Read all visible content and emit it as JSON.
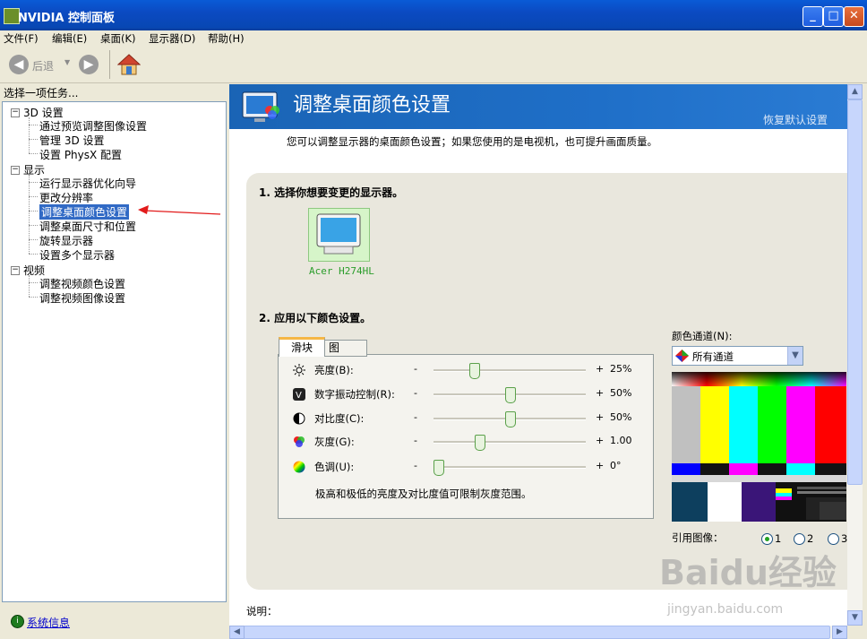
{
  "window": {
    "title": "NVIDIA 控制面板",
    "min": "_",
    "max": "□",
    "close": "✕"
  },
  "menu": [
    "文件(F)",
    "编辑(E)",
    "桌面(K)",
    "显示器(D)",
    "帮助(H)"
  ],
  "toolbar": {
    "back": "后退"
  },
  "left": {
    "header": "选择一项任务...",
    "groups": [
      {
        "label": "3D 设置",
        "items": [
          "通过预览调整图像设置",
          "管理 3D 设置",
          "设置 PhysX 配置"
        ]
      },
      {
        "label": "显示",
        "items": [
          "运行显示器优化向导",
          "更改分辨率",
          "调整桌面颜色设置",
          "调整桌面尺寸和位置",
          "旋转显示器",
          "设置多个显示器"
        ]
      },
      {
        "label": "视频",
        "items": [
          "调整视频颜色设置",
          "调整视频图像设置"
        ]
      }
    ],
    "selected": "调整桌面颜色设置",
    "sysinfo": "系统信息"
  },
  "page": {
    "title": "调整桌面颜色设置",
    "restore": "恢复默认设置",
    "intro": "您可以调整显示器的桌面颜色设置；如果您使用的是电视机，也可提升画面质量。",
    "step1": "1. 选择你想要变更的显示器。",
    "monitor": "Acer H274HL",
    "step2": "2. 应用以下颜色设置。",
    "tabs": {
      "slider": "滑块",
      "graph": "图"
    },
    "sliders": [
      {
        "label": "亮度(B):",
        "value": "25%",
        "level": 0.25,
        "icon": "brightness-icon"
      },
      {
        "label": "数字振动控制(R):",
        "value": "50%",
        "level": 0.5,
        "icon": "vibrance-icon"
      },
      {
        "label": "对比度(C):",
        "value": "50%",
        "level": 0.5,
        "icon": "contrast-icon"
      },
      {
        "label": "灰度(G):",
        "value": "1.00",
        "level": 0.29,
        "icon": "gamma-icon"
      },
      {
        "label": "色调(U):",
        "value": "0°",
        "level": 0.0,
        "icon": "hue-icon"
      }
    ],
    "minus": "-",
    "plus": "+",
    "note": "极高和极低的亮度及对比度值可限制灰度范围。",
    "channel_label": "颜色通道(N):",
    "channel_value": "所有通道",
    "ref_label": "引用图像：",
    "ref_options": [
      "1",
      "2",
      "3"
    ],
    "ref_selected": "1",
    "desc_label": "说明："
  },
  "watermark": {
    "main": "Baidu经验",
    "sub": "jingyan.baidu.com"
  },
  "colors": {
    "title_blue": "#0b4ac2",
    "banner": "#1f6fc8",
    "selected": "#316ac5",
    "link": "#0000cc"
  }
}
